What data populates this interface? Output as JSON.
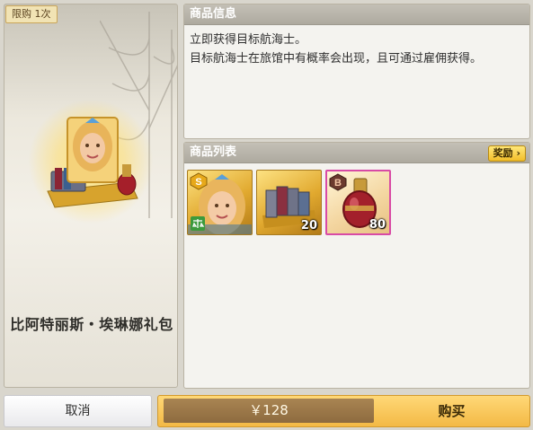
{
  "left_panel": {
    "limit_badge": "限购 1次",
    "title": "比阿特丽斯・埃琳娜礼包"
  },
  "info_panel": {
    "header": "商品信息",
    "description": "立即获得目标航海士。\n目标航海士在旅馆中有概率会出现，且可通过雇佣获得。"
  },
  "list_panel": {
    "header": "商品列表",
    "reward_button": "奖励",
    "items": [
      {
        "name": "navigator-beatrice",
        "badge": "S",
        "qty": ""
      },
      {
        "name": "books",
        "badge": "",
        "qty": "20"
      },
      {
        "name": "potion",
        "badge": "B",
        "qty": "80"
      }
    ]
  },
  "footer": {
    "cancel": "取消",
    "price": "￥128",
    "buy": "购买"
  },
  "colors": {
    "accent_gold": "#f3b945",
    "rare_border": "#d84aa5",
    "panel_header": "#aeaa9f"
  }
}
